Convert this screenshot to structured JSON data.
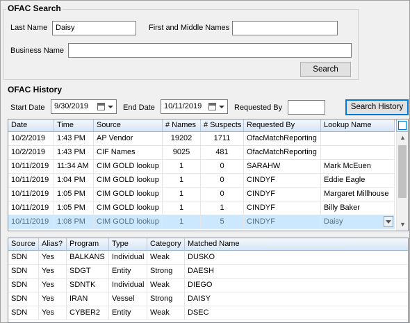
{
  "search": {
    "title": "OFAC Search",
    "last_name_label": "Last Name",
    "last_name_value": "Daisy",
    "first_middle_label": "First and Middle Names",
    "first_middle_value": "",
    "business_name_label": "Business Name",
    "business_name_value": "",
    "search_button": "Search"
  },
  "history": {
    "title": "OFAC History",
    "start_date_label": "Start Date",
    "start_date_value": "9/30/2019",
    "end_date_label": "End Date",
    "end_date_value": "10/11/2019",
    "requested_by_label": "Requested By",
    "requested_by_value": "",
    "search_history_button": "Search History",
    "columns": [
      "Date",
      "Time",
      "Source",
      "# Names",
      "# Suspects",
      "Requested By",
      "Lookup Name"
    ],
    "rows": [
      [
        "10/2/2019",
        "1:43 PM",
        "AP Vendor",
        "19202",
        "1711",
        "OfacMatchReporting",
        ""
      ],
      [
        "10/2/2019",
        "1:43 PM",
        "CIF Names",
        "9025",
        "481",
        "OfacMatchReporting",
        ""
      ],
      [
        "10/11/2019",
        "11:34 AM",
        "CIM GOLD lookup",
        "1",
        "0",
        "SARAHW",
        "Mark McEuen"
      ],
      [
        "10/11/2019",
        "1:04 PM",
        "CIM GOLD lookup",
        "1",
        "0",
        "CINDYF",
        "Eddie Eagle"
      ],
      [
        "10/11/2019",
        "1:05 PM",
        "CIM GOLD lookup",
        "1",
        "0",
        "CINDYF",
        "Margaret Millhouse"
      ],
      [
        "10/11/2019",
        "1:05 PM",
        "CIM GOLD lookup",
        "1",
        "1",
        "CINDYF",
        "Billy Baker"
      ],
      [
        "10/11/2019",
        "1:08 PM",
        "CIM GOLD lookup",
        "1",
        "5",
        "CINDYF",
        "Daisy"
      ]
    ],
    "selected_row": 6
  },
  "matches": {
    "columns": [
      "Source",
      "Alias?",
      "Program",
      "Type",
      "Category",
      "Matched Name"
    ],
    "rows": [
      [
        "SDN",
        "Yes",
        "BALKANS",
        "Individual",
        "Weak",
        "DUSKO"
      ],
      [
        "SDN",
        "Yes",
        "SDGT",
        "Entity",
        "Strong",
        "DAESH"
      ],
      [
        "SDN",
        "Yes",
        "SDNTK",
        "Individual",
        "Weak",
        "DIEGO"
      ],
      [
        "SDN",
        "Yes",
        "IRAN",
        "Vessel",
        "Strong",
        "DAISY"
      ],
      [
        "SDN",
        "Yes",
        "CYBER2",
        "Entity",
        "Weak",
        "DSEC"
      ]
    ]
  },
  "icons": {
    "calendar": "calendar-icon",
    "dropdown": "chevron-down-icon",
    "scroll_up": "scroll-up-arrow-icon",
    "scroll_down": "scroll-down-arrow-icon"
  }
}
